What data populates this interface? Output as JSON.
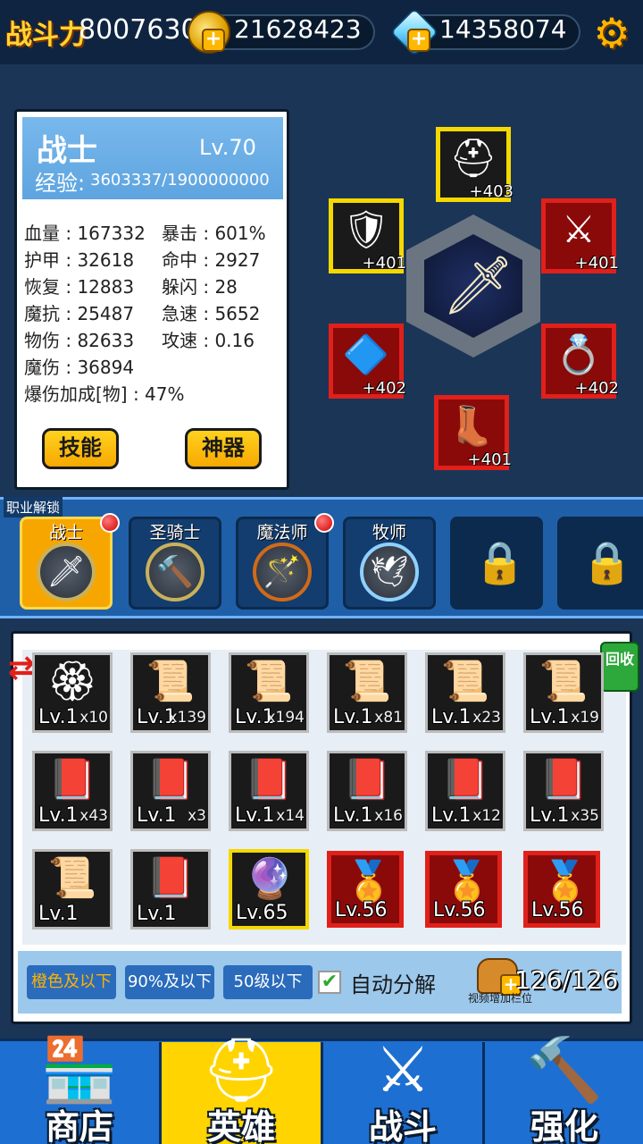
{
  "top_bar": {
    "combat_power_label": "战斗力",
    "combat_power_value": "8007630",
    "gold_value": "21628423",
    "gem_value": "14358074",
    "plus_symbol": "+",
    "settings_icon": "gear-icon"
  },
  "hero": {
    "class_name": "战士",
    "level": "Lv.70",
    "exp_label": "经验:",
    "exp_value": "3603337/1900000000",
    "stats": [
      {
        "text": "血量 : 167332"
      },
      {
        "text": "暴击 : 601%"
      },
      {
        "text": "护甲 : 32618"
      },
      {
        "text": "命中 : 2927"
      },
      {
        "text": "恢复 : 12883"
      },
      {
        "text": "躲闪 : 28"
      },
      {
        "text": "魔抗 : 25487"
      },
      {
        "text": "急速 : 5652"
      },
      {
        "text": "物伤 : 82633"
      },
      {
        "text": "攻速 : 0.16"
      },
      {
        "text": "魔伤 : 36894"
      },
      {
        "text": "爆伤加成[物] : 47%"
      }
    ],
    "skill_button": "技能",
    "artifact_button": "神器"
  },
  "equipment": {
    "slots": [
      {
        "bonus": "+403",
        "icon": "helmet-icon",
        "frame": "yellow"
      },
      {
        "bonus": "+401",
        "icon": "armor-icon",
        "frame": "yellow"
      },
      {
        "bonus": "+401",
        "icon": "weapon-icon",
        "frame": "red"
      },
      {
        "bonus": "+402",
        "icon": "amulet-icon",
        "frame": "red"
      },
      {
        "bonus": "+402",
        "icon": "ring-icon",
        "frame": "red"
      },
      {
        "bonus": "+401",
        "icon": "boots-icon",
        "frame": "red"
      }
    ]
  },
  "classes": {
    "unlock_label": "职业解锁",
    "items": [
      {
        "name": "战士",
        "icon": "sword-icon",
        "active": true,
        "badge": true
      },
      {
        "name": "圣骑士",
        "icon": "hammer-icon",
        "active": false,
        "badge": false
      },
      {
        "name": "魔法师",
        "icon": "staff-icon",
        "active": false,
        "badge": true
      },
      {
        "name": "牧师",
        "icon": "wings-icon",
        "active": false,
        "badge": false
      },
      {
        "name": "",
        "icon": "lock-icon",
        "locked": true
      },
      {
        "name": "",
        "icon": "lock-icon",
        "locked": true
      }
    ]
  },
  "inventory": {
    "recycle_label": "回收",
    "items": [
      {
        "lv": "Lv.1",
        "qty": "x10",
        "icon": "golden-rune-icon",
        "frame": "normal"
      },
      {
        "lv": "Lv.1",
        "qty": "x139",
        "icon": "scroll-icon",
        "frame": "normal"
      },
      {
        "lv": "Lv.1",
        "qty": "x194",
        "icon": "scroll-icon",
        "frame": "normal"
      },
      {
        "lv": "Lv.1",
        "qty": "x81",
        "icon": "scroll-icon",
        "frame": "normal"
      },
      {
        "lv": "Lv.1",
        "qty": "x23",
        "icon": "scroll-icon",
        "frame": "normal"
      },
      {
        "lv": "Lv.1",
        "qty": "x19",
        "icon": "scroll-icon",
        "frame": "normal"
      },
      {
        "lv": "Lv.1",
        "qty": "x43",
        "icon": "spellbook-icon",
        "frame": "normal"
      },
      {
        "lv": "Lv.1",
        "qty": "x3",
        "icon": "spellbook-icon",
        "frame": "normal"
      },
      {
        "lv": "Lv.1",
        "qty": "x14",
        "icon": "spellbook-icon",
        "frame": "normal"
      },
      {
        "lv": "Lv.1",
        "qty": "x16",
        "icon": "spellbook-icon",
        "frame": "normal"
      },
      {
        "lv": "Lv.1",
        "qty": "x12",
        "icon": "spellbook-icon",
        "frame": "normal"
      },
      {
        "lv": "Lv.1",
        "qty": "x35",
        "icon": "spellbook-icon",
        "frame": "normal"
      },
      {
        "lv": "Lv.1",
        "qty": "",
        "icon": "scroll-icon",
        "frame": "normal"
      },
      {
        "lv": "Lv.1",
        "qty": "",
        "icon": "spellbook-icon",
        "frame": "normal"
      },
      {
        "lv": "Lv.65",
        "qty": "",
        "icon": "crystal-icon",
        "frame": "gold"
      },
      {
        "lv": "Lv.56",
        "qty": "",
        "icon": "emblem-icon",
        "frame": "red"
      },
      {
        "lv": "Lv.56",
        "qty": "",
        "icon": "emblem-icon",
        "frame": "red"
      },
      {
        "lv": "Lv.56",
        "qty": "",
        "icon": "emblem-icon",
        "frame": "red"
      }
    ],
    "filters": [
      "橙色及以下",
      "90%及以下",
      "50级以下"
    ],
    "auto_decompose_label": "自动分解",
    "auto_decompose_checked": true,
    "capacity": "126/126",
    "capacity_note": "视频增加栏位"
  },
  "bottom_nav": {
    "tabs": [
      {
        "label": "商店",
        "icon": "shop-icon",
        "active": false
      },
      {
        "label": "英雄",
        "icon": "hero-helmet-icon",
        "active": true
      },
      {
        "label": "战斗",
        "icon": "crossed-swords-icon",
        "active": false
      },
      {
        "label": "强化",
        "icon": "anvil-hammer-icon",
        "active": false
      }
    ]
  },
  "colors": {
    "background": "#1b3556",
    "accent_yellow": "#ffd400",
    "nav_blue": "#1e6fd2",
    "rare_red": "#e0201a",
    "legend_gold": "#f5d800"
  }
}
